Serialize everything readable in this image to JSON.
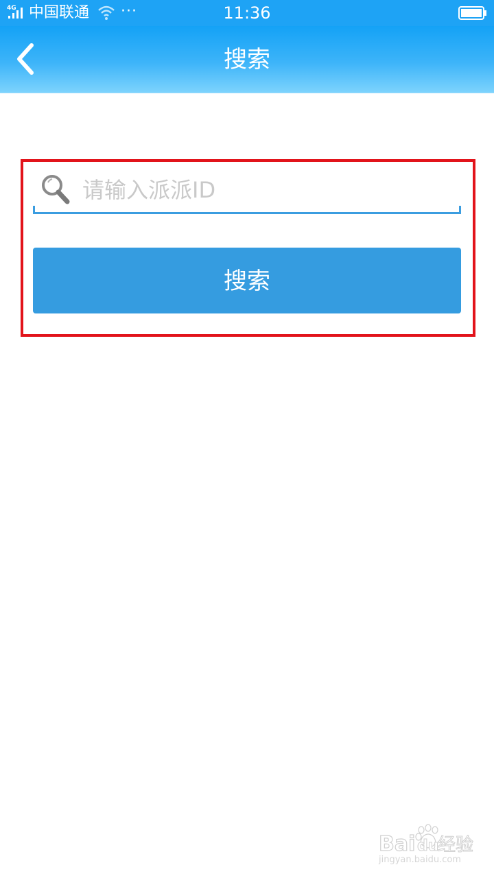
{
  "status_bar": {
    "network": "4G",
    "carrier": "中国联通",
    "more": "···",
    "time": "11:36"
  },
  "header": {
    "title": "搜索"
  },
  "search": {
    "placeholder": "请输入派派ID",
    "value": "",
    "button_label": "搜索"
  },
  "watermark": {
    "brand": "Baidu经验",
    "url": "jingyan.baidu.com"
  },
  "colors": {
    "header": "#1ea3f5",
    "button": "#359ce0",
    "highlight": "#e2141b"
  }
}
